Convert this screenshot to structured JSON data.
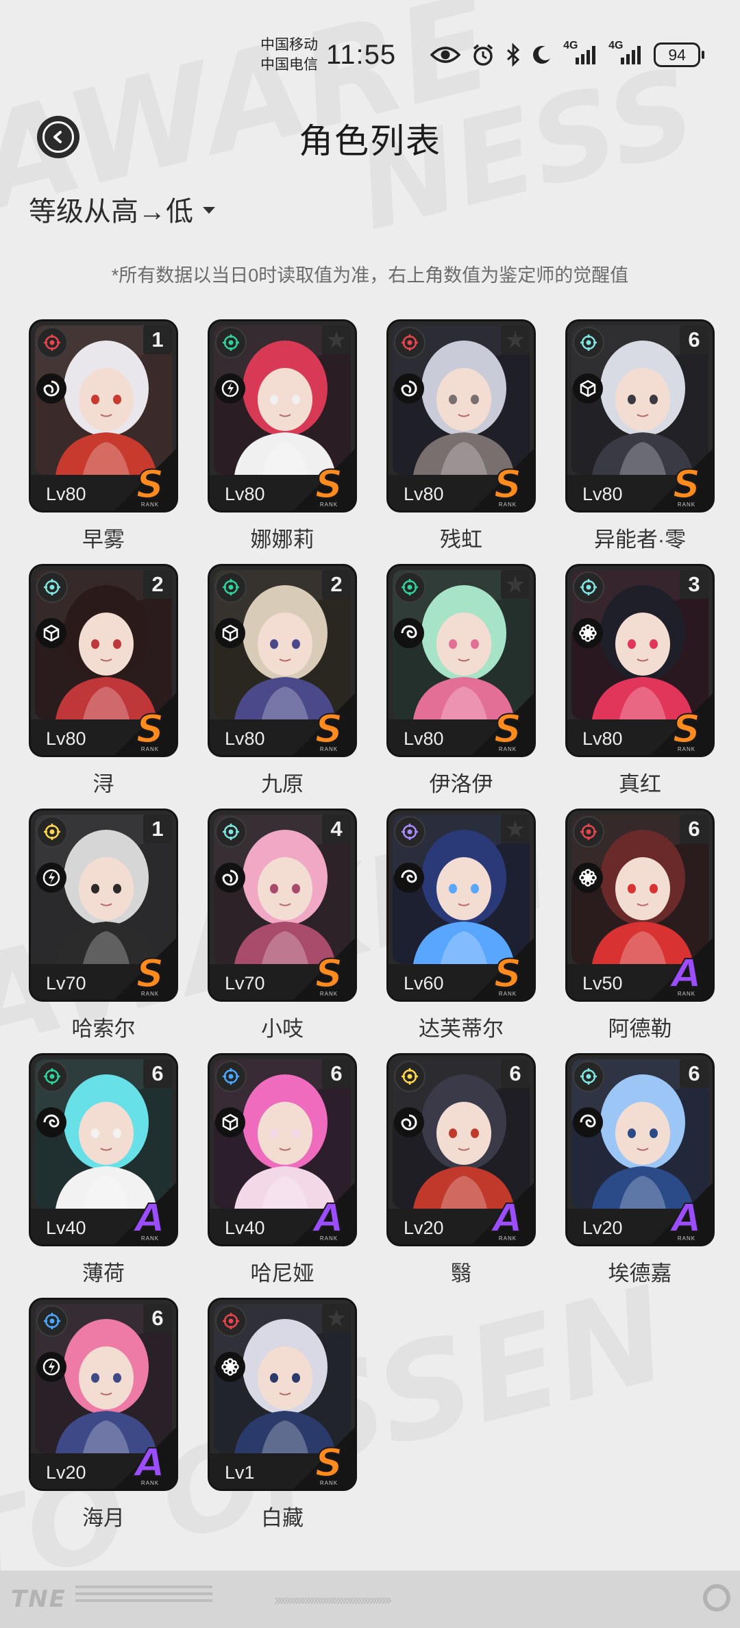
{
  "status_bar": {
    "carrier_1": "中国移动",
    "carrier_2": "中国电信",
    "time": "11:55",
    "network_1": "4G",
    "network_2": "4G",
    "battery": "94",
    "icons": [
      "eye-icon",
      "alarm-icon",
      "bluetooth-icon",
      "moon-icon",
      "signal-icon",
      "signal-icon"
    ]
  },
  "header": {
    "title": "角色列表",
    "back_icon": "back-arrow-icon"
  },
  "sort": {
    "label": "等级从高→低"
  },
  "note": "*所有数据以当日0时读取值为准，右上角数值为鉴定师的觉醒值",
  "rank_sub": "RANK",
  "colors": {
    "rank_s": "#ff8a1e",
    "rank_a": "#9b4dff",
    "attr_red": "#e8454e",
    "attr_green": "#2fd39a",
    "attr_cyan": "#7fe6e0",
    "attr_blue": "#4aa9ff",
    "attr_purple": "#a88cff",
    "attr_yellow": "#ffd84a"
  },
  "characters": [
    {
      "name": "早雾",
      "level": "Lv80",
      "rank": "S",
      "awakening": "1",
      "attr": "red",
      "type": "spiral"
    },
    {
      "name": "娜娜莉",
      "level": "Lv80",
      "rank": "S",
      "awakening": "",
      "attr": "green",
      "type": "bolt"
    },
    {
      "name": "残虹",
      "level": "Lv80",
      "rank": "S",
      "awakening": "",
      "attr": "red",
      "type": "spiral"
    },
    {
      "name": "异能者·零",
      "level": "Lv80",
      "rank": "S",
      "awakening": "6",
      "attr": "cyan",
      "type": "cube"
    },
    {
      "name": "浔",
      "level": "Lv80",
      "rank": "S",
      "awakening": "2",
      "attr": "cyan",
      "type": "cube"
    },
    {
      "name": "九原",
      "level": "Lv80",
      "rank": "S",
      "awakening": "2",
      "attr": "green",
      "type": "cube"
    },
    {
      "name": "伊洛伊",
      "level": "Lv80",
      "rank": "S",
      "awakening": "",
      "attr": "green",
      "type": "swirl"
    },
    {
      "name": "真红",
      "level": "Lv80",
      "rank": "S",
      "awakening": "3",
      "attr": "cyan",
      "type": "flower"
    },
    {
      "name": "哈索尔",
      "level": "Lv70",
      "rank": "S",
      "awakening": "1",
      "attr": "yellow",
      "type": "bolt"
    },
    {
      "name": "小吱",
      "level": "Lv70",
      "rank": "S",
      "awakening": "4",
      "attr": "cyan",
      "type": "spiral"
    },
    {
      "name": "达芙蒂尔",
      "level": "Lv60",
      "rank": "S",
      "awakening": "",
      "attr": "purple",
      "type": "swirl"
    },
    {
      "name": "阿德勒",
      "level": "Lv50",
      "rank": "A",
      "awakening": "6",
      "attr": "red",
      "type": "flower"
    },
    {
      "name": "薄荷",
      "level": "Lv40",
      "rank": "A",
      "awakening": "6",
      "attr": "green",
      "type": "swirl"
    },
    {
      "name": "哈尼娅",
      "level": "Lv40",
      "rank": "A",
      "awakening": "6",
      "attr": "blue",
      "type": "cube"
    },
    {
      "name": "翳",
      "level": "Lv20",
      "rank": "A",
      "awakening": "6",
      "attr": "yellow",
      "type": "spiral"
    },
    {
      "name": "埃德嘉",
      "level": "Lv20",
      "rank": "A",
      "awakening": "6",
      "attr": "cyan",
      "type": "swirl"
    },
    {
      "name": "海月",
      "level": "Lv20",
      "rank": "A",
      "awakening": "6",
      "attr": "blue",
      "type": "bolt"
    },
    {
      "name": "白藏",
      "level": "Lv1",
      "rank": "S",
      "awakening": "",
      "attr": "red",
      "type": "flower"
    }
  ]
}
